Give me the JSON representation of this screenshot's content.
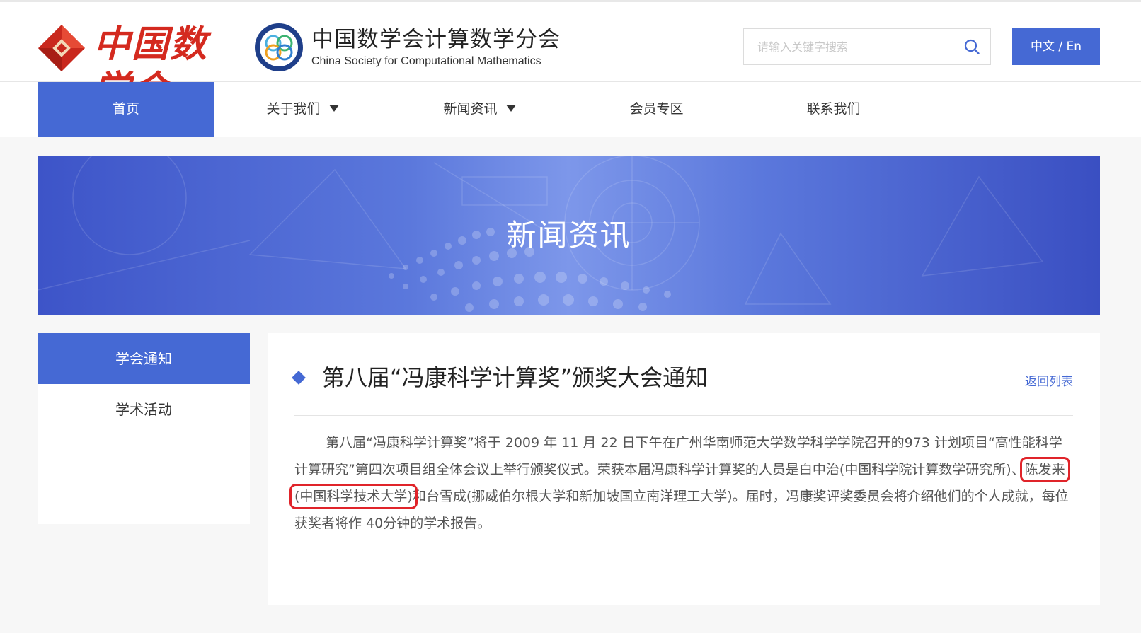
{
  "header": {
    "cms_logo_text": "中国数学会",
    "org_name": "中国数学会计算数学分会",
    "org_name_en": "China Society for Computational Mathematics",
    "search": {
      "placeholder": "请输入关键字搜索",
      "value": ""
    },
    "lang_label": "中文 / En"
  },
  "nav": {
    "items": [
      {
        "label": "首页",
        "active": true,
        "has_dropdown": false
      },
      {
        "label": "关于我们",
        "active": false,
        "has_dropdown": true
      },
      {
        "label": "新闻资讯",
        "active": false,
        "has_dropdown": true
      },
      {
        "label": "会员专区",
        "active": false,
        "has_dropdown": false
      },
      {
        "label": "联系我们",
        "active": false,
        "has_dropdown": false
      }
    ]
  },
  "banner": {
    "title": "新闻资讯"
  },
  "sidebar": {
    "items": [
      {
        "label": "学会通知",
        "active": true
      },
      {
        "label": "学术活动",
        "active": false
      }
    ]
  },
  "article": {
    "title": "第八届“冯康科学计算奖”颁奖大会通知",
    "back_label": "返回列表",
    "body_part1": "第八届“冯康科学计算奖”将于 2009 年 11 月 22 日下午在广州华南师范大学数学科学学院召开的973 计划项目“高性能科学计算研究”第四次项目组全体会议上举行颁奖仪式。荣获本届冯康科学计算奖的人员是白中治(中国科学院计算数学研究所)、",
    "body_highlight": "陈发来(中国科学技术大学)",
    "body_part2": "和台雪成(挪威伯尔根大学和新加坡国立南洋理工大学)。届时，冯康奖评奖委员会将介绍他们的个人成就，每位获奖者将作 40分钟的学术报告。"
  },
  "colors": {
    "accent": "#4569d4",
    "brand_red": "#d42a1f",
    "highlight_box": "#e0242a"
  }
}
